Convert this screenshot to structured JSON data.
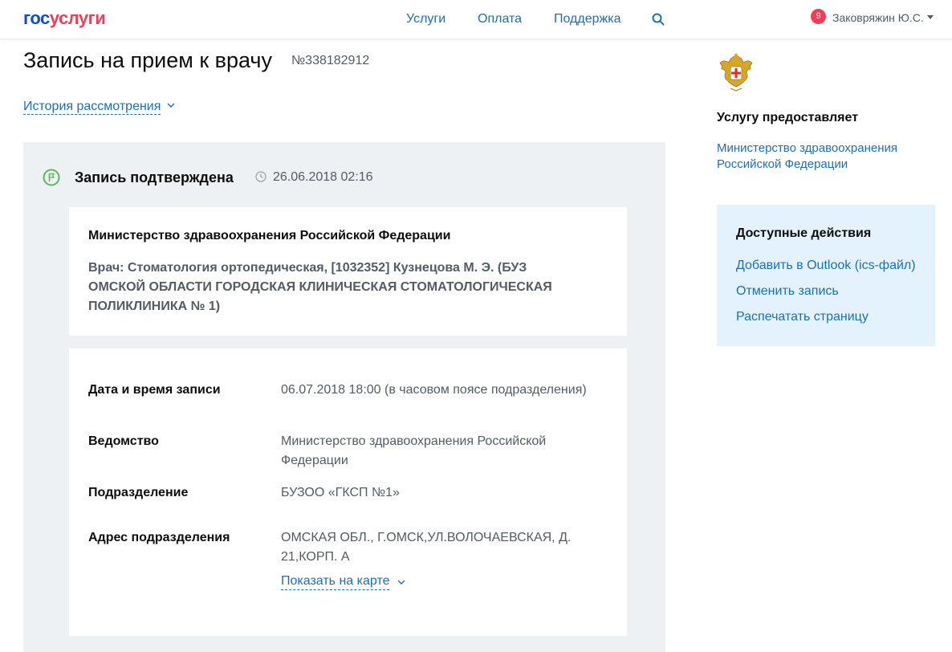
{
  "header": {
    "logo_part1": "гос",
    "logo_part2": "услуги",
    "nav": [
      "Услуги",
      "Оплата",
      "Поддержка"
    ],
    "notifications_count": "9",
    "user_name": "Заковряжин Ю.С."
  },
  "page": {
    "title": "Запись на прием к врачу",
    "order_number": "№338182912",
    "history_link": "История рассмотрения"
  },
  "status": {
    "title": "Запись подтверждена",
    "date": "26.06.2018 02:16"
  },
  "card1": {
    "organization": "Министерство здравоохранения Российской Федерации",
    "doctor": "Врач: Стоматология ортопедическая, [1032352] Кузнецова М. Э. (БУЗ ОМСКОЙ ОБЛАСТИ ГОРОДСКАЯ КЛИНИЧЕСКАЯ СТОМАТОЛОГИЧЕСКАЯ ПОЛИКЛИНИКА № 1)"
  },
  "details": [
    {
      "label": "Дата и время записи",
      "value": "06.07.2018 18:00 (в часовом поясе подразделения)"
    },
    {
      "label": "Ведомство",
      "value": "Министерство здравоохранения Российской Федерации"
    },
    {
      "label": "Подразделение",
      "value": "БУЗОО «ГКСП №1»"
    },
    {
      "label": "Адрес подразделения",
      "value": "ОМСКАЯ ОБЛ., Г.ОМСК,УЛ.ВОЛОЧАЕВСКАЯ, Д. 21,КОРП. А"
    }
  ],
  "map_link": "Показать на карте",
  "sidebar": {
    "provider_heading": "Услугу предоставляет",
    "provider_link": "Министерство здравоохранения Российской Федерации",
    "actions_heading": "Доступные действия",
    "actions": [
      "Добавить в Outlook (ics-файл)",
      "Отменить запись",
      "Распечатать страницу"
    ]
  },
  "colors": {
    "link": "#1c6fb4",
    "logo_blue": "#0d4cd3",
    "logo_red": "#ee3f58",
    "status_green": "#5cb85c",
    "actions_bg": "#e3f2fc",
    "block_bg": "#eef1f4"
  },
  "icons": [
    "search-icon",
    "chevron-down-icon",
    "flag-icon",
    "clock-icon",
    "emblem-icon",
    "caret-down-icon"
  ]
}
